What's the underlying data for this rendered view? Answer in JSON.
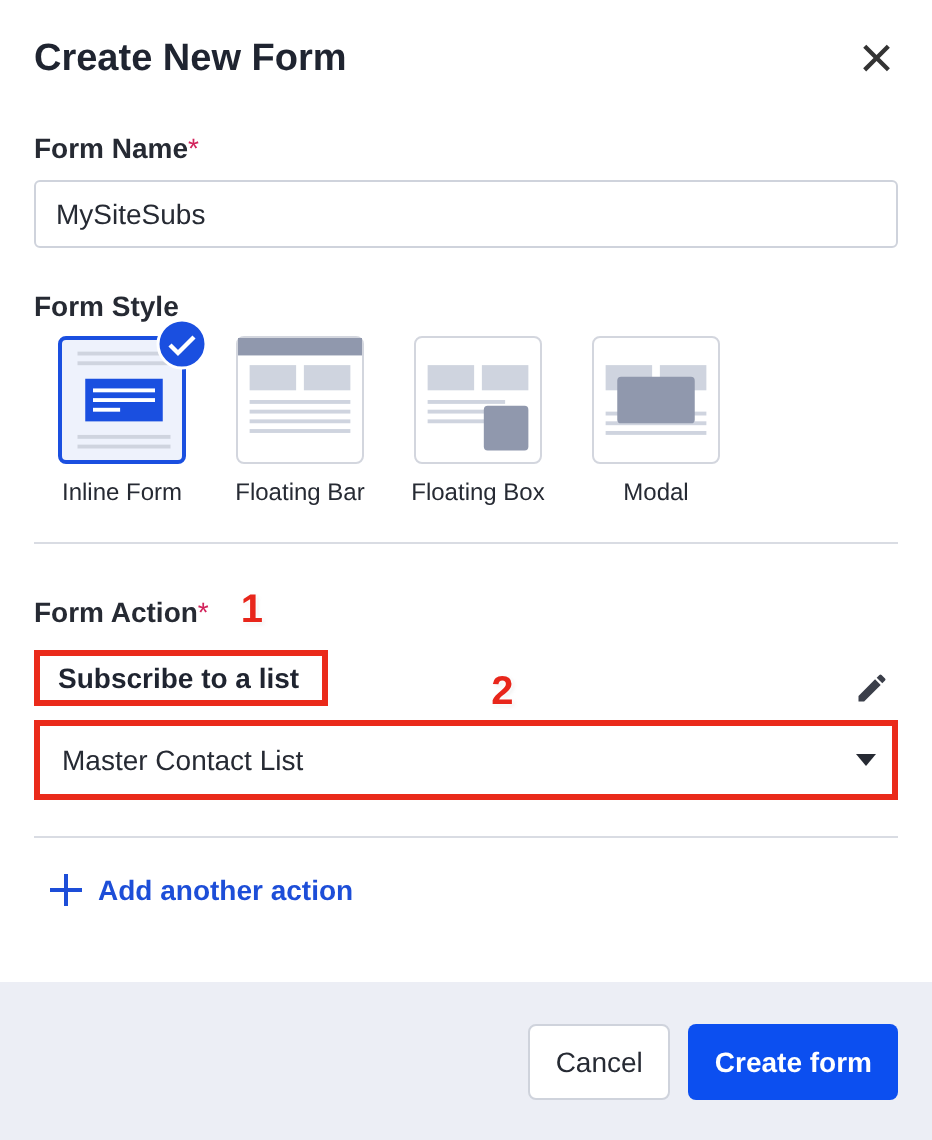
{
  "dialog": {
    "title": "Create New Form",
    "close_label": "×"
  },
  "form_name": {
    "label": "Form Name",
    "required_mark": "*",
    "value": "MySiteSubs"
  },
  "form_style": {
    "label": "Form Style",
    "options": [
      {
        "kind": "inline",
        "label": "Inline Form",
        "selected": true
      },
      {
        "kind": "bar",
        "label": "Floating Bar",
        "selected": false
      },
      {
        "kind": "box",
        "label": "Floating Box",
        "selected": false
      },
      {
        "kind": "modal",
        "label": "Modal",
        "selected": false
      }
    ]
  },
  "form_action": {
    "label": "Form Action",
    "required_mark": "*",
    "callout": "1",
    "action": {
      "title": "Subscribe to a list",
      "highlighted": true
    },
    "list_callout": "2",
    "list": {
      "value": "Master Contact List",
      "highlighted": true
    },
    "add_label": "Add another action"
  },
  "footer": {
    "buttons": [
      {
        "kind": "secondary",
        "label": "Cancel"
      },
      {
        "kind": "primary",
        "label": "Create form"
      }
    ]
  }
}
